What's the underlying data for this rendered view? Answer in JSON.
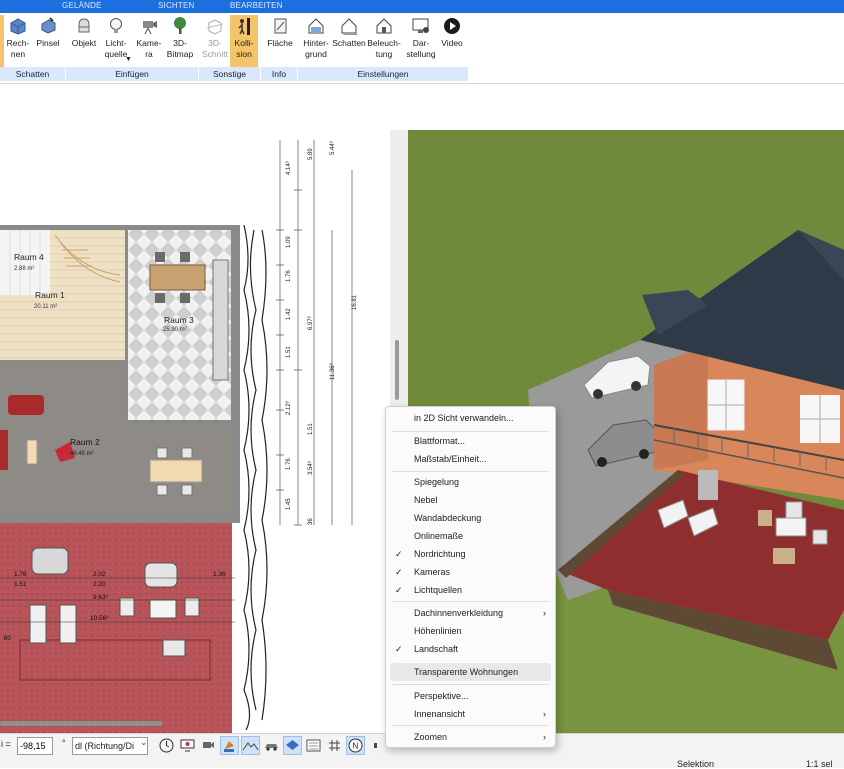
{
  "tabs": {
    "gelaende": "GELÄNDE",
    "sichten": "SICHTEN",
    "bearbeiten": "BEARBEITEN"
  },
  "ribbon": {
    "buttons": {
      "rechnen": "Rech-\nnen",
      "pinsel": "Pinsel",
      "objekt": "Objekt",
      "lichtquelle": "Licht-\nquelle",
      "kamera": "Kame-\nra",
      "bitmap3d": "3D-\nBitmap",
      "schnitt3d": "3D-\nSchnitt",
      "kollision": "Kolli-\nsion",
      "flaeche": "Fläche",
      "hintergrund": "Hinter-\ngrund",
      "schatten": "Schatten",
      "beleuchtung": "Beleuch-\ntung",
      "darstellung": "Dar-\nstellung",
      "video": "Video"
    },
    "groups": {
      "schatten": "Schatten",
      "einfuegen": "Einfügen",
      "sonstige": "Sonstige",
      "info": "Info",
      "einstellungen": "Einstellungen"
    }
  },
  "plan": {
    "rooms": [
      {
        "name": "Raum 4",
        "area": "2.88 m²"
      },
      {
        "name": "Raum 1",
        "area": "20.11 m²"
      },
      {
        "name": "Raum 3",
        "area": "25.90 m²"
      },
      {
        "name": "Raum 2",
        "area": "46.45 m²"
      }
    ],
    "dimensions_right": [
      "4.14³",
      "5.89",
      "5.44³",
      "1.09",
      "1.76",
      "1.42",
      "6.97³",
      "1.51",
      "11.36³",
      "16.81",
      "2.12³",
      "1.76",
      "3.54³",
      "1.51",
      "1.45",
      "36"
    ],
    "dimensions_bottom": [
      "1.76",
      "2.02",
      "1.36",
      "1.51",
      "2.20",
      "9.63³",
      "10.56³",
      ".60"
    ]
  },
  "status": {
    "angle_value": "-98,15",
    "angle_unit": "°",
    "direction_value": "dl (Richtung/Di",
    "left_label": "i =",
    "selection": "Selektion",
    "selection_count": "1:1 sel"
  },
  "context_menu": {
    "items": [
      {
        "label": "in 2D Sicht verwandeln...",
        "checked": false,
        "submenu": false
      },
      {
        "label": "Blattformat...",
        "checked": false,
        "submenu": false
      },
      {
        "label": "Maßstab/Einheit...",
        "checked": false,
        "submenu": false
      },
      {
        "label": "Spiegelung",
        "checked": false,
        "submenu": false
      },
      {
        "label": "Nebel",
        "checked": false,
        "submenu": false
      },
      {
        "label": "Wandabdeckung",
        "checked": false,
        "submenu": false
      },
      {
        "label": "Onlinemaße",
        "checked": false,
        "submenu": false
      },
      {
        "label": "Nordrichtung",
        "checked": true,
        "submenu": false
      },
      {
        "label": "Kameras",
        "checked": true,
        "submenu": false
      },
      {
        "label": "Lichtquellen",
        "checked": true,
        "submenu": false
      },
      {
        "label": "Dachinnenverkleidung",
        "checked": false,
        "submenu": true
      },
      {
        "label": "Höhenlinien",
        "checked": false,
        "submenu": false
      },
      {
        "label": "Landschaft",
        "checked": true,
        "submenu": false
      },
      {
        "label": "Transparente Wohnungen",
        "checked": false,
        "submenu": false
      },
      {
        "label": "Perspektive...",
        "checked": false,
        "submenu": false
      },
      {
        "label": "Innenansicht",
        "checked": false,
        "submenu": true
      },
      {
        "label": "Zoomen",
        "checked": false,
        "submenu": true
      }
    ],
    "check_glyph": "✓",
    "arrow_glyph": "›"
  },
  "colors": {
    "ribbon_tab_bg": "#1d6fe0",
    "group_label_bg": "#d9e9fb",
    "active_button": "#f4c46b",
    "grass": "#6f8a3a",
    "terrace": "#9c3a33"
  },
  "icons": [
    "rechnen-icon",
    "pinsel-icon",
    "objekt-icon",
    "lichtquelle-icon",
    "kamera-icon",
    "tree-icon",
    "schnitt-icon",
    "kollision-icon",
    "flaeche-icon",
    "hintergrund-icon",
    "schatten-icon",
    "beleuchtung-icon",
    "darstellung-icon",
    "video-icon"
  ]
}
